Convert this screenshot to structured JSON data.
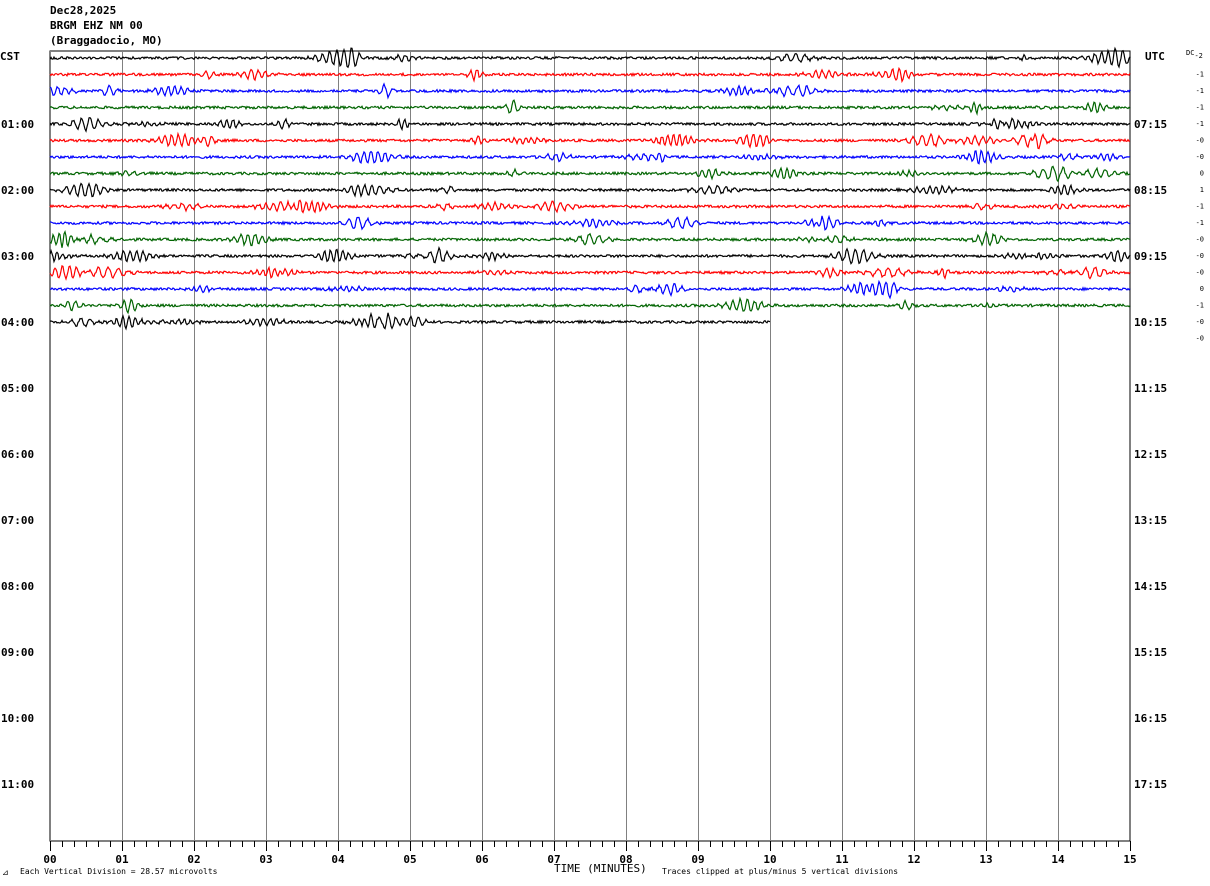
{
  "header": {
    "date": "Dec28,2025",
    "station": "BRGM EHZ NM 00",
    "location": "(Braggadocio, MO)"
  },
  "left_zone": "CST",
  "right_zone": "UTC",
  "dc_header": "DC",
  "dc_header_sub": "-2",
  "dc_values": [
    "-1",
    "-1",
    "-1",
    "-1",
    "-0",
    "-0",
    "0",
    "1",
    "-1",
    "-1",
    "-0",
    "-0",
    "-0",
    "0",
    "-1",
    "-0",
    "-0"
  ],
  "footer": {
    "left_note": "Each Vertical Division =   28.57 microvolts",
    "xlabel": "TIME (MINUTES)",
    "right_note": "Traces clipped at plus/minus 5 vertical divisions"
  },
  "chart_data": {
    "type": "line",
    "xlabel": "TIME (MINUTES)",
    "xlim": [
      0,
      15
    ],
    "x_ticks": [
      "00",
      "01",
      "02",
      "03",
      "04",
      "05",
      "06",
      "07",
      "08",
      "09",
      "10",
      "11",
      "12",
      "13",
      "14",
      "15"
    ],
    "y_left_ticks": [
      "01:00",
      "02:00",
      "03:00",
      "04:00",
      "05:00",
      "06:00",
      "07:00",
      "08:00",
      "09:00",
      "10:00",
      "11:00"
    ],
    "y_right_ticks": [
      "07:15",
      "08:15",
      "09:15",
      "10:15",
      "11:15",
      "12:15",
      "13:15",
      "14:15",
      "15:15",
      "16:15",
      "17:15"
    ],
    "trace_colors": [
      "#000000",
      "#ff0000",
      "#0000ff",
      "#006400"
    ],
    "trace_count": 17,
    "last_trace_end_minutes": 10.0,
    "grid": true
  }
}
